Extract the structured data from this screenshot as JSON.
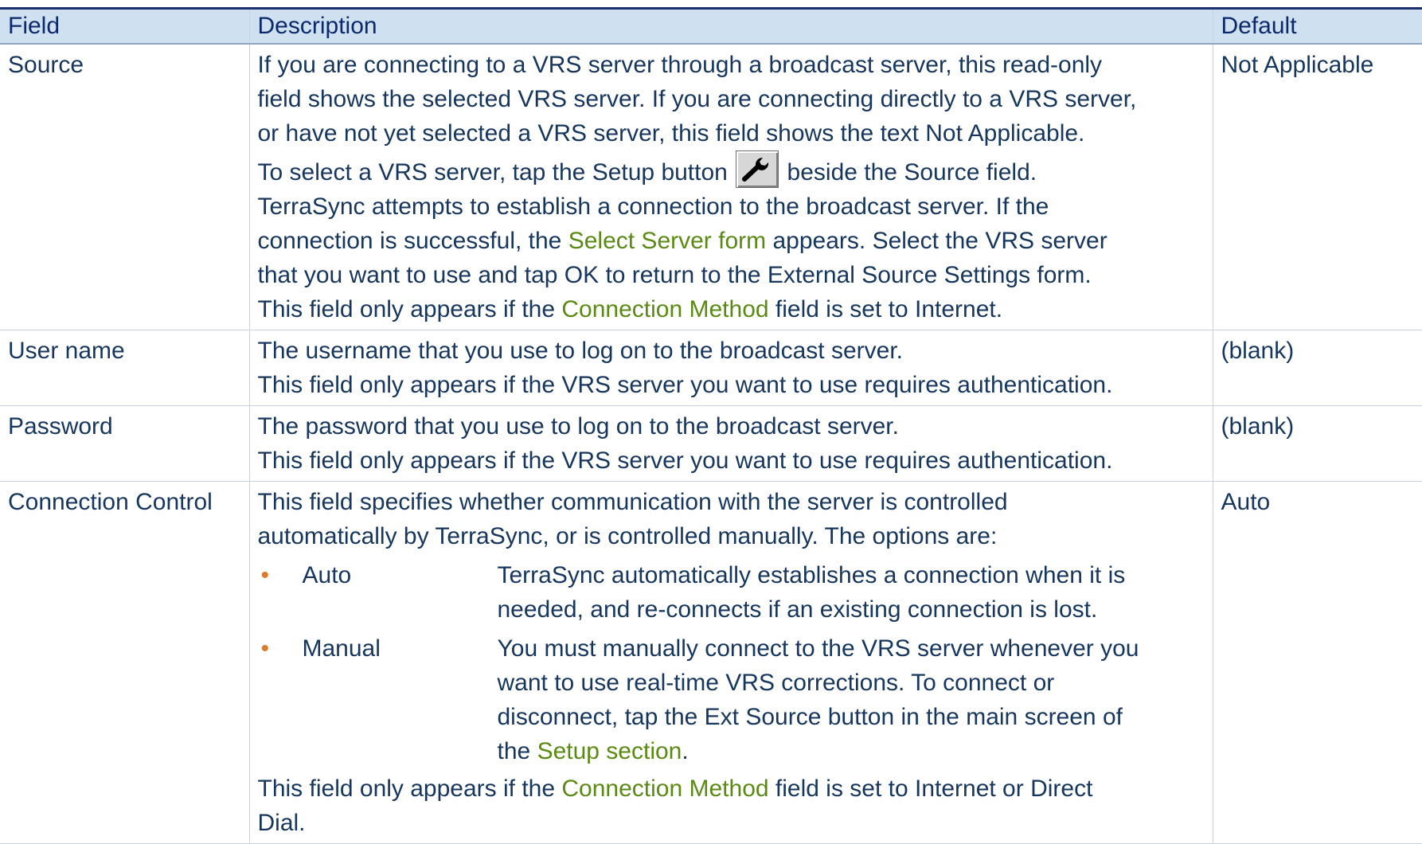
{
  "table": {
    "headers": {
      "field": "Field",
      "description": "Description",
      "default": "Default"
    },
    "rows": {
      "source": {
        "field": "Source",
        "lines": [
          "If you are connecting to a VRS server through a broadcast server, this read-only",
          "field shows the selected VRS server. If you are connecting directly to a VRS server,",
          "or have not yet selected a VRS server, this field shows the text Not Applicable."
        ],
        "setup_before": "To select a VRS server, tap the Setup button",
        "setup_after": "beside the Source field.",
        "attempt_line": "TerraSync attempts to establish a connection to the broadcast server. If the",
        "select_before": "connection is successful, the",
        "select_link": "Select Server form",
        "select_after": "appears. Select the VRS server",
        "ok_line": "that you want to use and tap OK to return to the External Source Settings form.",
        "note_before": "This field only appears if the",
        "note_link": "Connection Method",
        "note_after": "field is set to Internet.",
        "default": "Not Applicable",
        "icon": "wrench-icon"
      },
      "username": {
        "field": "User name",
        "line1": "The username that you use to log on to the broadcast server.",
        "line2": "This field only appears if the VRS server you want to use requires authentication.",
        "default": "(blank)"
      },
      "password": {
        "field": "Password",
        "line1": "The password that you use to log on to the broadcast server.",
        "line2": "This field only appears if the VRS server you want to use requires authentication.",
        "default": "(blank)"
      },
      "connection_control": {
        "field": "Connection Control",
        "line1": "This field specifies whether communication with the server is controlled",
        "line2": "automatically by TerraSync, or is controlled manually. The options are:",
        "options": [
          {
            "name": "Auto",
            "lines": [
              "TerraSync automatically establishes a connection when it is",
              "needed, and re-connects if an existing connection is lost."
            ]
          },
          {
            "name": "Manual",
            "lines": [
              "You must manually connect to the VRS server whenever you",
              "want to use real-time VRS corrections. To connect or",
              "disconnect, tap the Ext Source button in the main screen of"
            ],
            "last_before": "the",
            "last_link": "Setup section",
            "last_after": "."
          }
        ],
        "note_before": "This field only appears if the",
        "note_link": "Connection Method",
        "note_after": "field is set to Internet or Direct",
        "note_line2": "Dial.",
        "default": "Auto"
      }
    },
    "bullet": "•",
    "colors": {
      "header_bg": "#cfe0f1",
      "text": "#17365d",
      "link": "#5b8a14",
      "bullet": "#e07a26"
    }
  }
}
